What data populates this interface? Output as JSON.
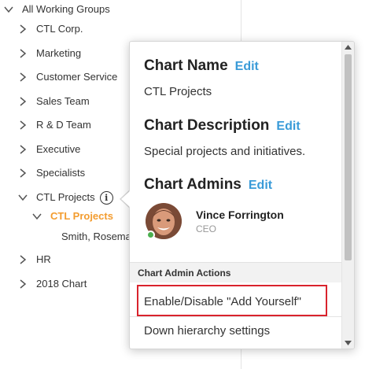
{
  "tree": {
    "root": "All Working Groups",
    "items": [
      {
        "label": "CTL Corp.",
        "expanded": false
      },
      {
        "label": "Marketing",
        "expanded": false
      },
      {
        "label": "Customer Service",
        "expanded": false
      },
      {
        "label": "Sales Team",
        "expanded": false
      },
      {
        "label": "R & D Team",
        "expanded": false
      },
      {
        "label": "Executive",
        "expanded": false
      },
      {
        "label": "Specialists",
        "expanded": false
      },
      {
        "label": "CTL Projects",
        "expanded": true
      },
      {
        "label": "CTL Projects",
        "expanded": true,
        "active": true
      },
      {
        "label": "Smith, Rosema"
      },
      {
        "label": "HR",
        "expanded": false
      },
      {
        "label": "2018 Chart",
        "expanded": false
      }
    ],
    "info_icon_glyph": "i",
    "active_color": "#f39c2f"
  },
  "popover": {
    "chart_name_title": "Chart Name",
    "chart_name_edit": "Edit",
    "chart_name_value": "CTL Projects",
    "chart_description_title": "Chart Description",
    "chart_description_edit": "Edit",
    "chart_description_value": "Special projects and initiatives.",
    "chart_admins_title": "Chart Admins",
    "chart_admins_edit": "Edit",
    "admin": {
      "name": "Vince Forrington",
      "role": "CEO",
      "status": "online"
    },
    "actions_header": "Chart Admin Actions",
    "actions": [
      {
        "label": "Enable/Disable \"Add Yourself\"",
        "highlighted": true
      },
      {
        "label": "Down hierarchy settings"
      }
    ],
    "link_color": "#3a9bd8",
    "highlight_color": "#d9232d"
  }
}
